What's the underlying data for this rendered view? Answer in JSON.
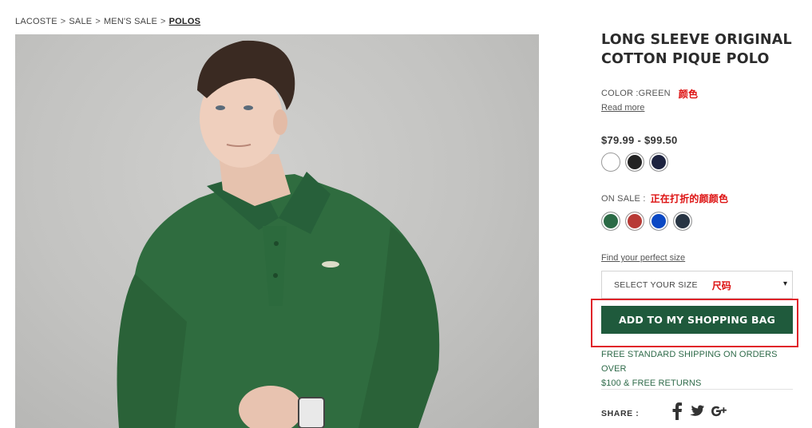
{
  "breadcrumb": {
    "items": [
      "LACOSTE",
      "SALE",
      "MEN'S SALE"
    ],
    "separator": ">",
    "current": "POLOS"
  },
  "product": {
    "title_line1": "LONG SLEEVE ORIGINAL",
    "title_line2": "COTTON PIQUE POLO",
    "color_label": "COLOR :GREEN",
    "read_more": "Read more",
    "price": "$79.99 - $99.50",
    "regular_colors": [
      "#ffffff",
      "#222222",
      "#1d2340"
    ],
    "on_sale_label": "ON SALE :",
    "sale_colors": [
      "#2a6a45",
      "#b83a36",
      "#0b48c4",
      "#283544"
    ],
    "find_size": "Find your perfect size",
    "size_placeholder": "SELECT YOUR SIZE",
    "size_arrow": "▾",
    "add_to_bag": "ADD TO MY SHOPPING BAG",
    "shipping_line1": "FREE STANDARD SHIPPING ON ORDERS OVER",
    "shipping_line2": "$100 & FREE RETURNS",
    "share_label": "SHARE :",
    "share_icons": [
      "facebook-icon",
      "twitter-icon",
      "google-plus-icon"
    ]
  },
  "annotations": {
    "color_note": "颜色",
    "sale_note": "正在打折的颜颜色",
    "size_note": "尺码",
    "highlight_color": "#e0242a"
  },
  "colors": {
    "button_green": "#1f5a3c",
    "shipping_green": "#2f6b4a",
    "annotation_red": "#dd1111"
  },
  "image": {
    "alt": "Model wearing green long sleeve polo"
  }
}
